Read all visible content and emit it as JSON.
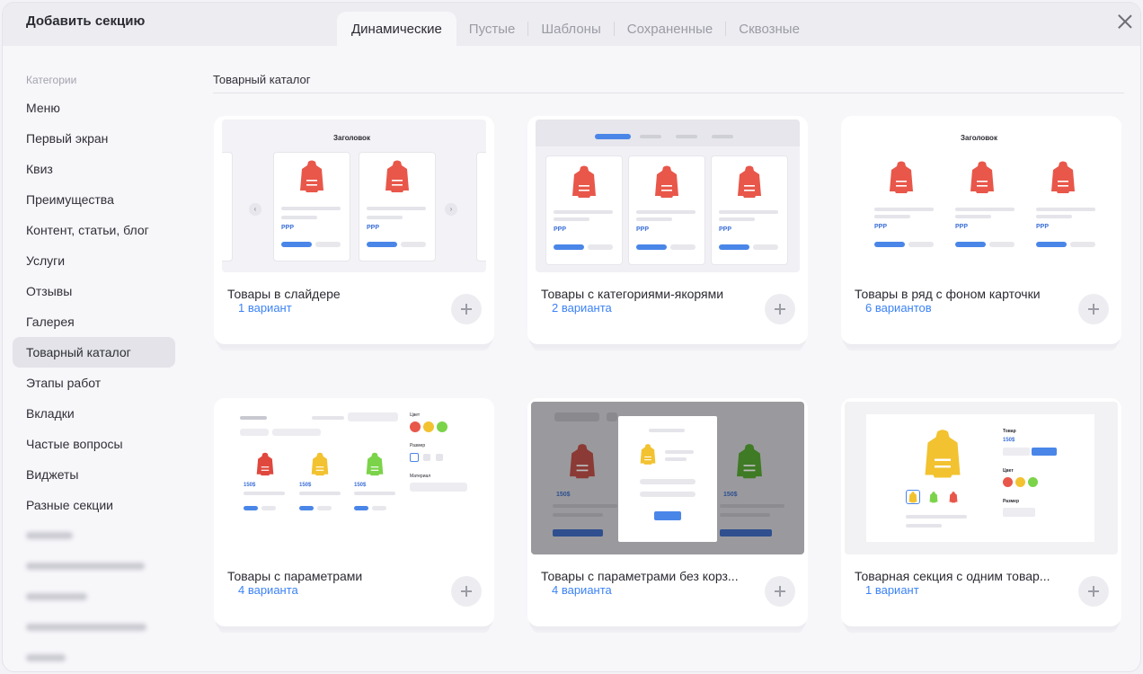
{
  "modal": {
    "title": "Добавить секцию"
  },
  "tabs": [
    {
      "label": "Динамические",
      "active": true
    },
    {
      "label": "Пустые"
    },
    {
      "label": "Шаблоны"
    },
    {
      "label": "Сохраненные"
    },
    {
      "label": "Сквозные"
    }
  ],
  "sidebar": {
    "title": "Категории",
    "items": [
      {
        "label": "Меню"
      },
      {
        "label": "Первый экран"
      },
      {
        "label": "Квиз"
      },
      {
        "label": "Преимущества"
      },
      {
        "label": "Контент, статьи, блог"
      },
      {
        "label": "Услуги"
      },
      {
        "label": "Отзывы"
      },
      {
        "label": "Галерея"
      },
      {
        "label": "Товарный каталог",
        "active": true
      },
      {
        "label": "Этапы работ"
      },
      {
        "label": "Вкладки"
      },
      {
        "label": "Частые вопросы"
      },
      {
        "label": "Виджеты"
      },
      {
        "label": "Разные секции"
      }
    ]
  },
  "section": {
    "title": "Товарный каталог"
  },
  "cards": [
    {
      "title": "Товары в слайдере",
      "variants": "1 вариант",
      "preview_heading": "Заголовок",
      "price": "PPP"
    },
    {
      "title": "Товары с категориями-якорями",
      "variants": "2 варианта",
      "price": "PPP"
    },
    {
      "title": "Товары в ряд с фоном карточки",
      "variants": "6 вариантов",
      "preview_heading": "Заголовок",
      "price": "PPP"
    },
    {
      "title": "Товары с параметрами",
      "variants": "4 варианта",
      "price": "150$",
      "color_label": "Цвет",
      "size_label": "Размер",
      "material_label": "Материал"
    },
    {
      "title": "Товары с параметрами без корз...",
      "variants": "4 варианта",
      "price": "150$"
    },
    {
      "title": "Товарная секция с одним товар...",
      "variants": "1 вариант",
      "product_label": "Товар",
      "price": "150$",
      "color_label": "Цвет",
      "size_label": "Размер"
    }
  ],
  "colors": {
    "accent": "#3b82f6",
    "jacket_red": "#e8574a",
    "jacket_yellow": "#f2c230",
    "jacket_green": "#5fbf3a"
  }
}
